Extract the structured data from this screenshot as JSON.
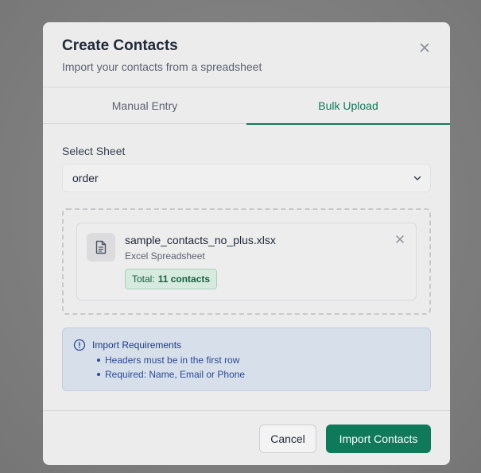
{
  "dialog": {
    "title": "Create Contacts",
    "subtitle": "Import your contacts from a spreadsheet"
  },
  "tabs": [
    {
      "label": "Manual Entry",
      "active": false
    },
    {
      "label": "Bulk Upload",
      "active": true
    }
  ],
  "sheet_select": {
    "label": "Select Sheet",
    "value": "order"
  },
  "file": {
    "name": "sample_contacts_no_plus.xlsx",
    "type": "Excel Spreadsheet",
    "total_label": "Total:",
    "total_count": "11 contacts"
  },
  "requirements": {
    "title": "Import Requirements",
    "items": [
      "Headers must be in the first row",
      "Required: Name, Email or Phone"
    ]
  },
  "footer": {
    "cancel_label": "Cancel",
    "import_label": "Import Contacts"
  },
  "icons": {
    "close": "close-icon",
    "chevron": "chevron-down-icon",
    "file": "file-text-icon",
    "info": "info-circle-icon"
  },
  "colors": {
    "accent": "#0f7a5a",
    "info_text": "#1e3a8a",
    "badge_bg": "#d7eadf"
  }
}
